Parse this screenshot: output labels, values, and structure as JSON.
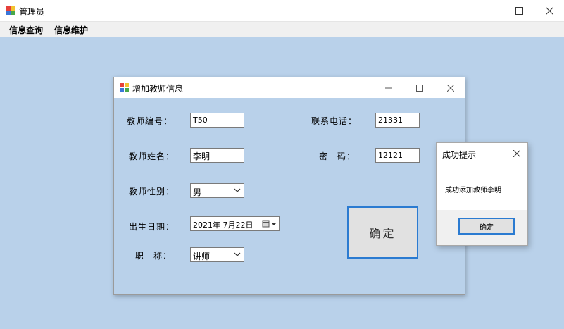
{
  "main_window": {
    "title": "管理员",
    "menu": [
      "信息查询",
      "信息维护"
    ]
  },
  "dialog": {
    "title": "增加教师信息",
    "fields": {
      "teacher_id": {
        "label": "教师编号：",
        "value": "T50"
      },
      "phone": {
        "label": "联系电话：",
        "value": "21331"
      },
      "teacher_name": {
        "label": "教师姓名：",
        "value": "李明"
      },
      "password": {
        "label": "密　码：",
        "value": "12121"
      },
      "gender": {
        "label": "教师性别：",
        "value": "男"
      },
      "birth_date": {
        "label": "出生日期：",
        "value": "2021年  7月22日"
      },
      "title_rank": {
        "label": "职　称：",
        "value": "讲师"
      }
    },
    "confirm_label": "确定"
  },
  "message_box": {
    "title": "成功提示",
    "text": "成功添加教师李明",
    "ok_label": "确定"
  },
  "colors": {
    "background": "#b9d1ea",
    "focus_border": "#2b7bd1"
  }
}
